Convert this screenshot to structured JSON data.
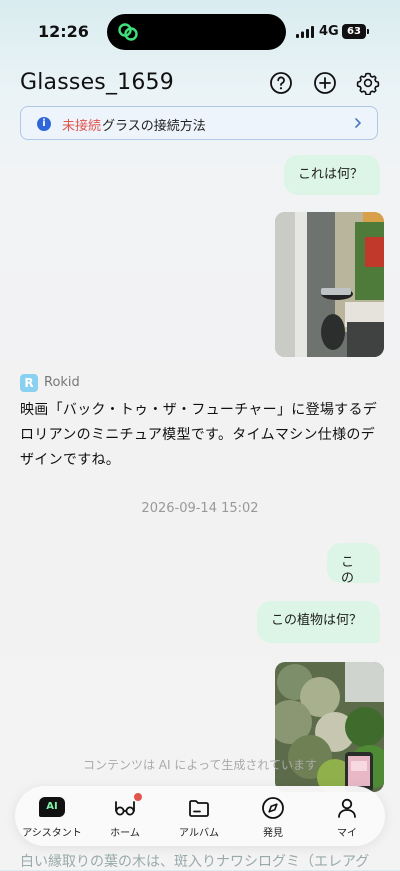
{
  "status_bar": {
    "time": "12:26",
    "network": "4G",
    "battery": "63"
  },
  "header": {
    "title": "Glasses_1659",
    "icons": [
      "help-icon",
      "add-icon",
      "settings-icon"
    ]
  },
  "banner": {
    "status": "未接続",
    "text": "グラスの接続方法"
  },
  "messages": {
    "q1": "これは何？",
    "bot_name": "Rokid",
    "bot_answer": "映画「バック・トゥ・ザ・フューチャー」に登場するデロリアンのミニチュア模型です。タイムマシン仕様のデザインですね。",
    "timestamp": "2026-09-14 15:02",
    "q2": "この",
    "q3": "この植物は何？",
    "disclaimer": "コンテンツは AI によって生成されています",
    "partial_answer": "白い縁取りの葉の木は、斑入りナワシログミ（エレアグ"
  },
  "nav": [
    {
      "label": "アシスタント",
      "icon": "ai-icon"
    },
    {
      "label": "ホーム",
      "icon": "glasses-icon"
    },
    {
      "label": "アルバム",
      "icon": "folder-icon"
    },
    {
      "label": "発見",
      "icon": "compass-icon"
    },
    {
      "label": "マイ",
      "icon": "person-icon"
    }
  ],
  "colors": {
    "accent": "#2f66d9",
    "warning": "#e2554d",
    "user_bubble": "#dcf5e6"
  }
}
